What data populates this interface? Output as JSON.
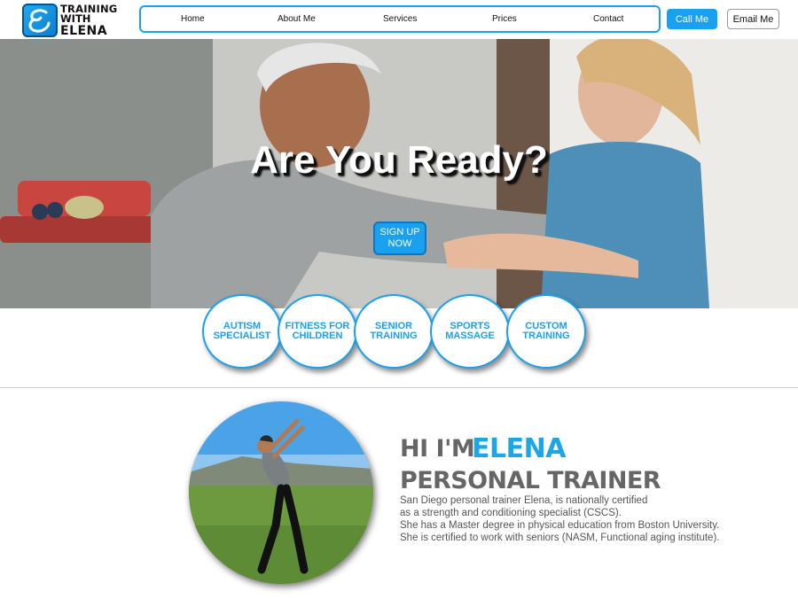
{
  "logo": {
    "line1": "TRAINING",
    "line2": "WITH",
    "line3": "ELENA",
    "icon": "script-e-logo-icon",
    "accent": "#1aa0ee"
  },
  "nav": {
    "items": [
      "Home",
      "About Me",
      "Services",
      "Prices",
      "Contact"
    ]
  },
  "header_buttons": {
    "call": "Call Me",
    "email": "Email Me"
  },
  "hero": {
    "title": "Are You Ready?",
    "signup_line1": "SIGN UP",
    "signup_line2": "NOW"
  },
  "services": [
    {
      "line1": "AUTISM",
      "line2": "SPECIALIST"
    },
    {
      "line1": "FITNESS FOR",
      "line2": "CHILDREN"
    },
    {
      "line1": "SENIOR",
      "line2": "TRAINING"
    },
    {
      "line1": "SPORTS",
      "line2": "MASSAGE"
    },
    {
      "line1": "CUSTOM",
      "line2": "TRAINING"
    }
  ],
  "about": {
    "hi": "HI I'M",
    "name": "ELENA",
    "role": "PERSONAL TRAINER",
    "lines": [
      "San Diego personal trainer Elena, is nationally certified",
      "as a strength and conditioning specialist (CSCS).",
      "She has a Master degree in physical education from Boston University.",
      "She is certified to work with seniors (NASM, Functional aging institute)."
    ]
  },
  "colors": {
    "primary": "#1aa0ee",
    "name_blue": "#1ba7e6",
    "heading_gray": "#666666"
  }
}
